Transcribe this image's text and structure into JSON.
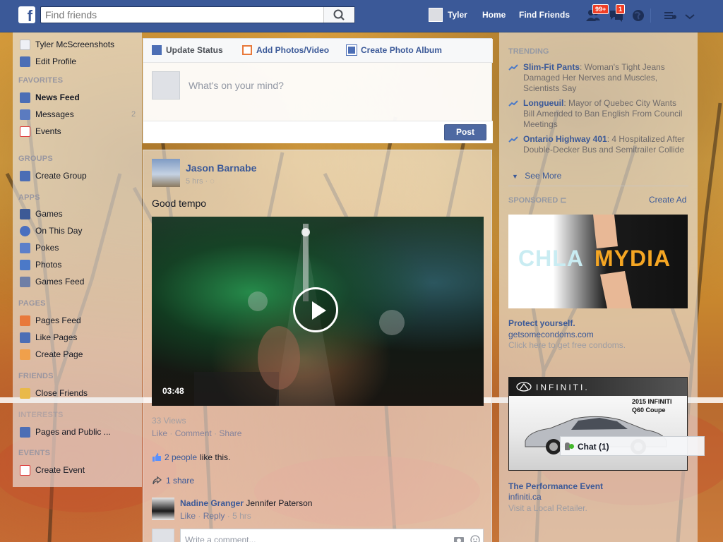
{
  "topbar": {
    "logo": "f",
    "search_placeholder": "Find friends",
    "user_name": "Tyler",
    "links": [
      "Home",
      "Find Friends"
    ],
    "friend_requests_badge": "99+",
    "messages_badge": "1"
  },
  "left_nav": {
    "profile_name": "Tyler McScreenshots",
    "edit_profile": "Edit Profile",
    "favorites_header": "FAVORITES",
    "news_feed": "News Feed",
    "messages": "Messages",
    "messages_count": "2",
    "events": "Events",
    "groups_header": "GROUPS",
    "create_group": "Create Group",
    "apps_header": "APPS",
    "games": "Games",
    "on_this_day": "On This Day",
    "pokes": "Pokes",
    "photos": "Photos",
    "games_feed": "Games Feed",
    "pages_header": "PAGES",
    "pages_feed": "Pages Feed",
    "like_pages": "Like Pages",
    "create_page": "Create Page",
    "friends_header": "FRIENDS",
    "close_friends": "Close Friends",
    "interests_header": "INTERESTS",
    "pages_and_public": "Pages and Public ...",
    "events_header": "EVENTS",
    "create_event": "Create Event"
  },
  "composer": {
    "tab_status": "Update Status",
    "tab_photos": "Add Photos/Video",
    "tab_album": "Create Photo Album",
    "placeholder": "What's on your mind?",
    "post_button": "Post"
  },
  "story": {
    "author": "Jason Barnabe",
    "time": "5 hrs",
    "text": "Good tempo",
    "video_duration": "03:48",
    "views": "33 Views",
    "actions": [
      "Like",
      "Comment",
      "Share"
    ],
    "likes_link": "2 people",
    "likes_suffix": "like this.",
    "shares": "1 share",
    "comment": {
      "author": "Nadine Granger",
      "text": "Jennifer Paterson",
      "actions": [
        "Like",
        "Reply"
      ],
      "time": "5 hrs"
    },
    "write_comment_placeholder": "Write a comment..."
  },
  "right_col": {
    "trending_header": "TRENDING",
    "trends": [
      {
        "title": "Slim-Fit Pants",
        "desc": ": Woman's Tight Jeans Damaged Her Nerves and Muscles, Scientists Say"
      },
      {
        "title": "Longueuil",
        "desc": ": Mayor of Quebec City Wants Bill Amended to Ban English From Council Meetings"
      },
      {
        "title": "Ontario Highway 401",
        "desc": ": 4 Hospitalized After Double-Decker Bus and Semitrailer Collide"
      }
    ],
    "see_more": "See More",
    "sponsored_header": "SPONSORED",
    "create_ad": "Create Ad",
    "ad1": {
      "image_text_a": "CHLA",
      "image_text_b": "MYDIA",
      "title": "Protect yourself.",
      "url": "getsomecondoms.com",
      "desc": "Click here to get free condoms."
    },
    "ad2": {
      "brand": "INFINITI.",
      "model_line1": "2015 INFINITI",
      "model_line2": "Q60 Coupe",
      "title": "The Performance Event",
      "url": "infiniti.ca",
      "desc": "Visit a Local Retailer."
    }
  },
  "chat": {
    "label": "Chat (1)"
  },
  "colors": {
    "fb_blue": "#3b5998",
    "link_blue": "#3b5998",
    "post_button": "#4e69a2",
    "badge_red": "#f03d25",
    "online_green": "#42b72a"
  }
}
